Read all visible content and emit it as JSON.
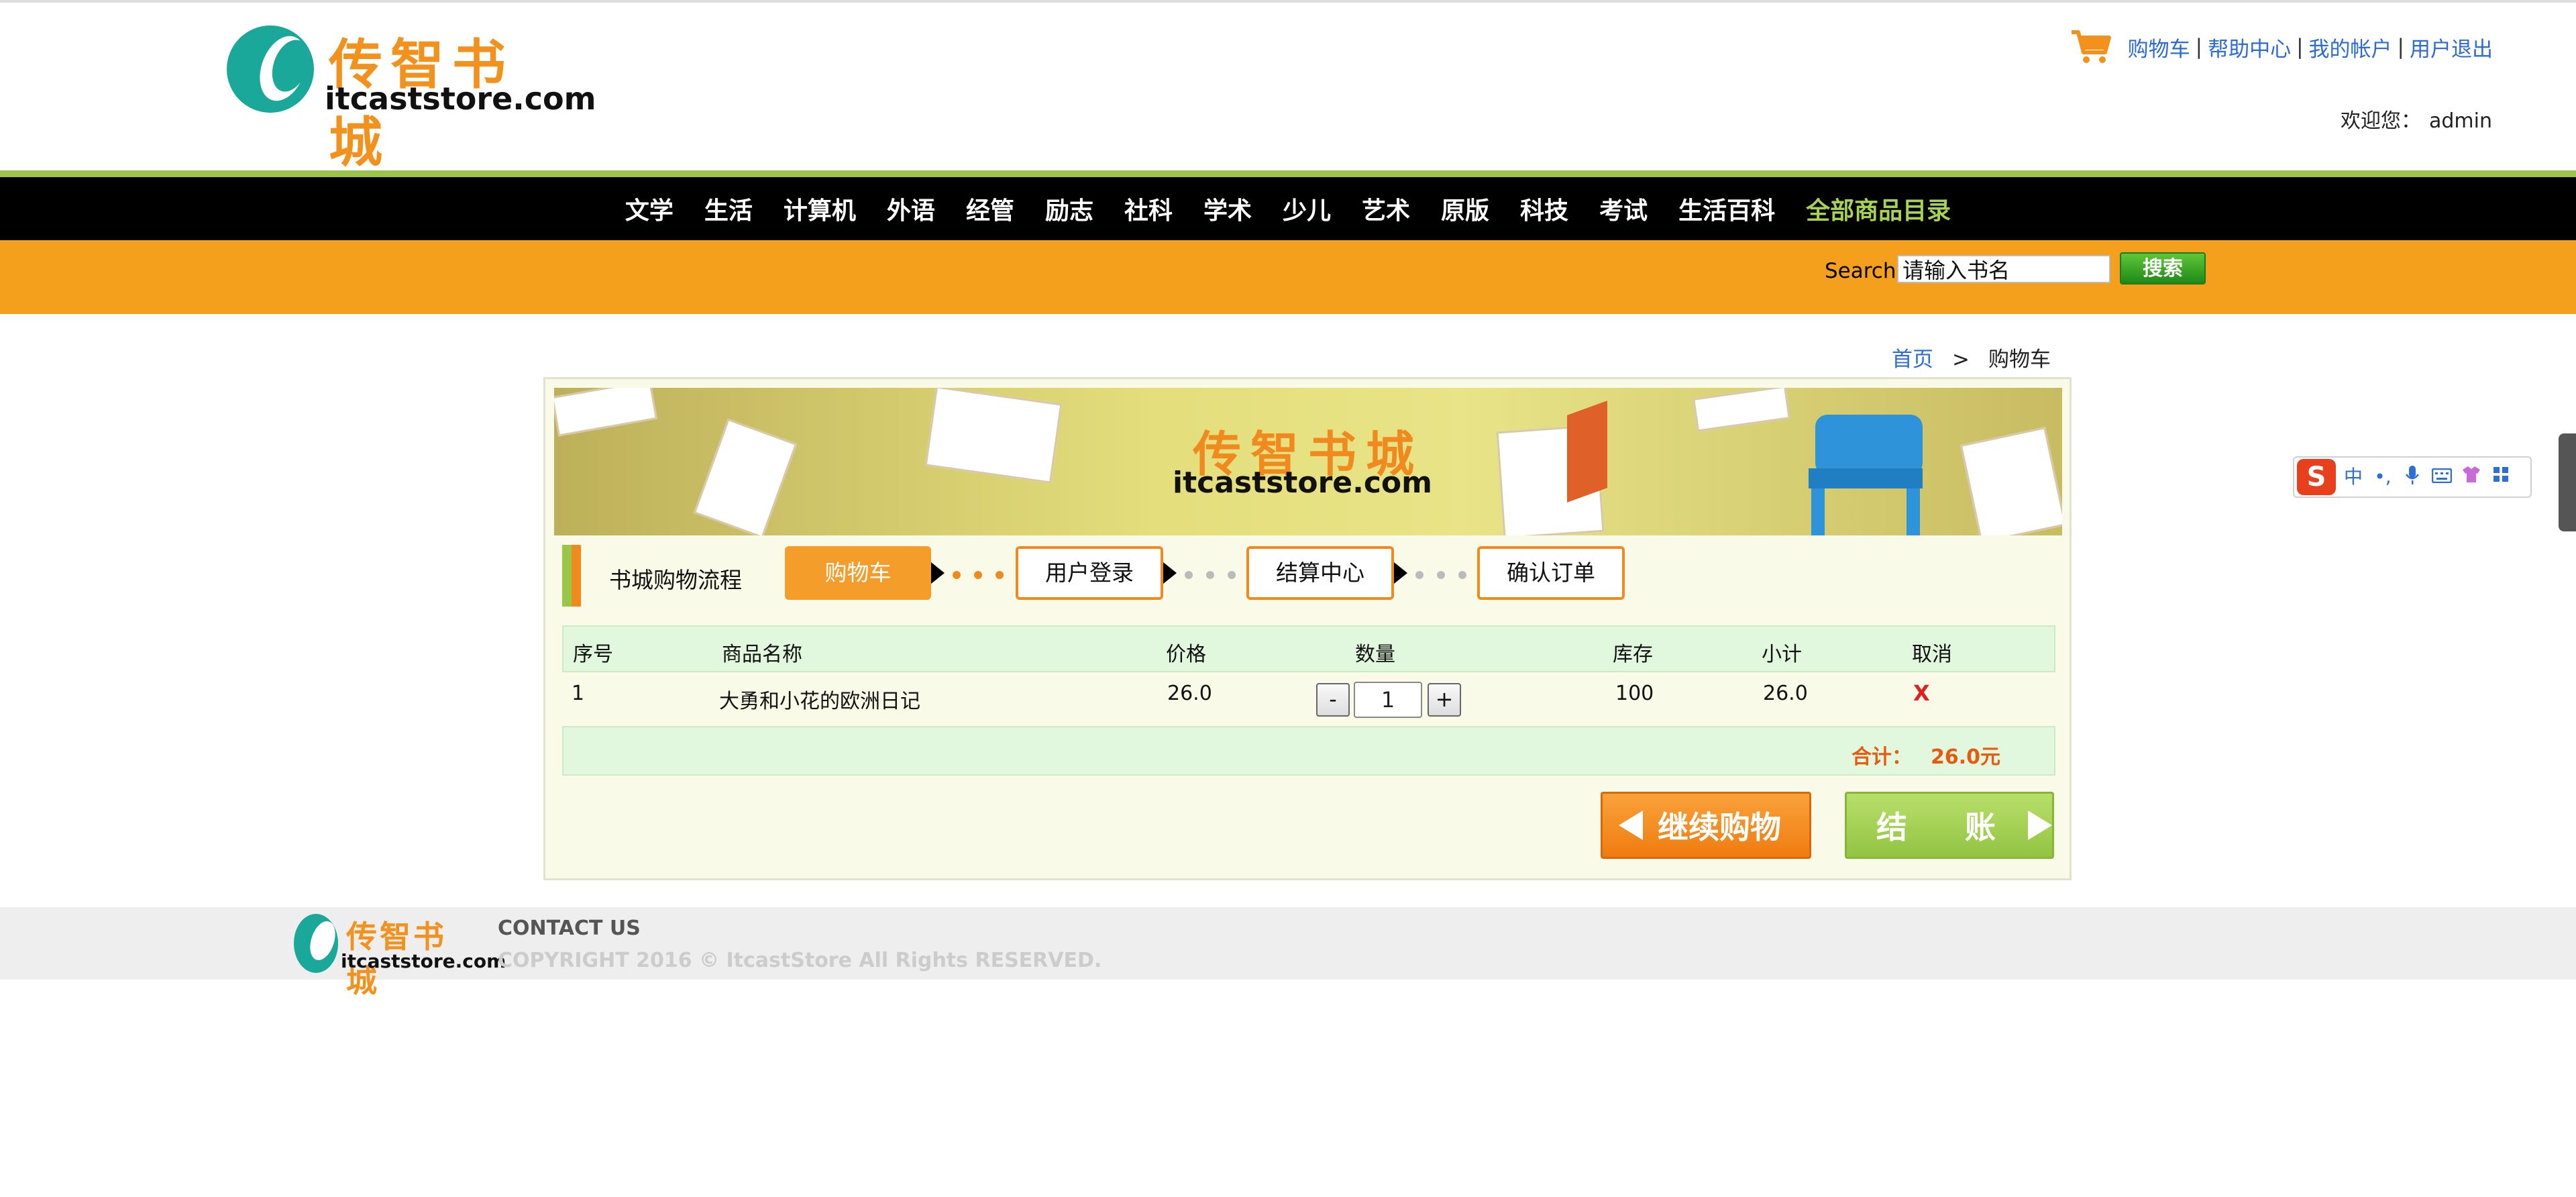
{
  "header": {
    "logo_cn": "传智书城",
    "logo_en": "itcaststore.com",
    "links": [
      "购物车",
      "帮助中心",
      "我的帐户",
      "用户退出"
    ],
    "separator": "|",
    "welcome_label": "欢迎您：",
    "username": "admin"
  },
  "nav": {
    "items": [
      "文学",
      "生活",
      "计算机",
      "外语",
      "经管",
      "励志",
      "社科",
      "学术",
      "少儿",
      "艺术",
      "原版",
      "科技",
      "考试",
      "生活百科"
    ],
    "all_label": "全部商品目录"
  },
  "search": {
    "label": "Search",
    "value": "请输入书名",
    "button": "搜索"
  },
  "breadcrumb": {
    "home": "首页",
    "arrow": ">",
    "current": "购物车"
  },
  "banner": {
    "title_cn": "传智书城",
    "title_en": "itcaststore.com"
  },
  "process": {
    "label": "书城购物流程",
    "steps": [
      "购物车",
      "用户登录",
      "结算中心",
      "确认订单"
    ]
  },
  "cart": {
    "headers": [
      "序号",
      "商品名称",
      "价格",
      "数量",
      "库存",
      "小计",
      "取消"
    ],
    "rows": [
      {
        "index": "1",
        "name": "大勇和小花的欧洲日记",
        "price": "26.0",
        "quantity": "1",
        "stock": "100",
        "subtotal": "26.0",
        "cancel": "X"
      }
    ],
    "minus": "-",
    "plus": "+",
    "total_label": "合计：",
    "total_value": "26.0元"
  },
  "actions": {
    "continue": "继续购物",
    "checkout": "结　账"
  },
  "footer": {
    "logo_cn": "传智书城",
    "logo_en": "itcaststore.com",
    "contact": "CONTACT US",
    "copyright": "COPYRIGHT 2016 © ItcastStore All Rights RESERVED."
  },
  "ime": {
    "logo": "S",
    "mode": "中"
  },
  "colors": {
    "brand_orange": "#f5a01d",
    "nav_black": "#000000",
    "nav_accent": "#a6d350",
    "link_blue": "#2a6bd8",
    "table_head": "#e2f8de",
    "total_red": "#e85a10"
  }
}
